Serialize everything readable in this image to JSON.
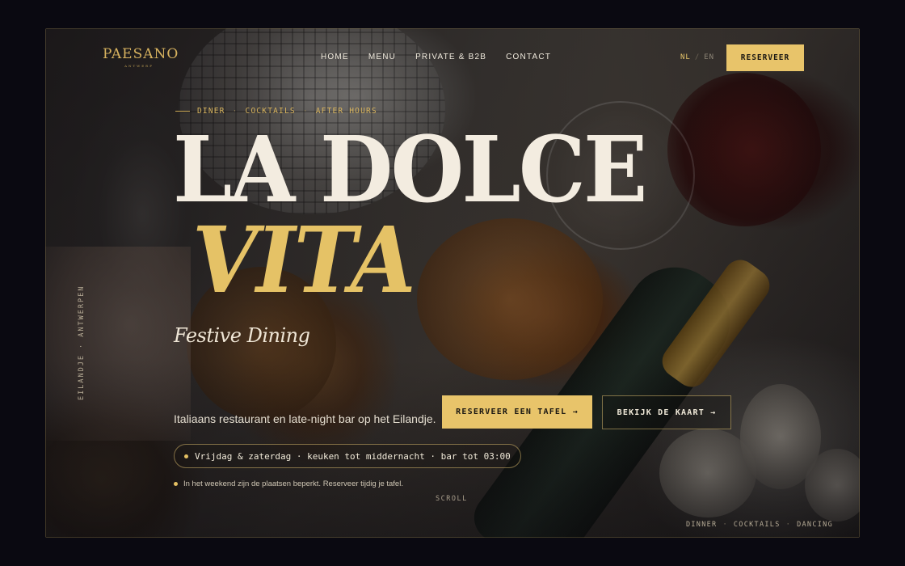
{
  "brand": {
    "logo_text": "PAESANO",
    "logo_sub": "ANTWERP"
  },
  "nav": {
    "items": [
      "HOME",
      "MENU",
      "PRIVATE & B2B",
      "CONTACT"
    ]
  },
  "language": {
    "active": "NL",
    "separator": "/",
    "inactive": "EN"
  },
  "header": {
    "reserve_label": "RESERVEER"
  },
  "hero": {
    "tagline": [
      "DINER",
      "COCKTAILS",
      "AFTER HOURS"
    ],
    "tagline_separator": "·",
    "title_line1": "LA DOLCE",
    "title_line2": "VITA",
    "script": "Festive Dining",
    "lede": "Italiaans restaurant en late-night bar op het Eilandje.",
    "hours": "Vrijdag & zaterdag · keuken tot middernacht · bar tot 03:00",
    "note": "In het weekend zijn de plaatsen beperkt. Reserveer tijdig je tafel.",
    "cta_primary": "RESERVEER EEN TAFEL →",
    "cta_secondary": "BEKIJK DE KAART →",
    "scroll_label": "SCROLL",
    "vertical_label": "EILANDJE · ANTWERPEN"
  },
  "footer": {
    "tags": [
      "DINNER",
      "COCKTAILS",
      "DANCING"
    ],
    "separator": "·"
  },
  "colors": {
    "accent": "#e8c46a",
    "cream": "#f3ece0",
    "background": "#0a0911"
  }
}
